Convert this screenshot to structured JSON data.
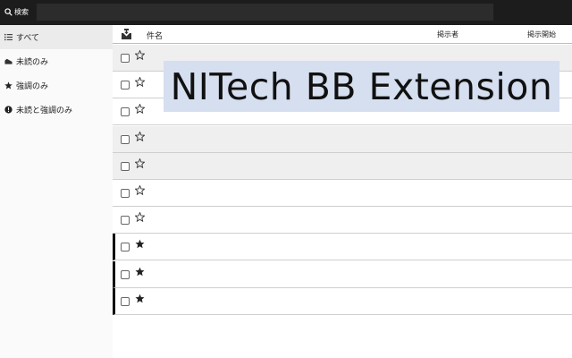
{
  "search": {
    "label": "検索",
    "value": "",
    "placeholder": ""
  },
  "sidebar": {
    "items": [
      {
        "label": "すべて",
        "icon": "list-icon",
        "active": true
      },
      {
        "label": "未読のみ",
        "icon": "unread-mail-icon",
        "active": false
      },
      {
        "label": "強調のみ",
        "icon": "star-icon",
        "active": false
      },
      {
        "label": "未読と強調のみ",
        "icon": "info-icon",
        "active": false
      }
    ]
  },
  "table": {
    "header_icon": "mail-icon",
    "columns": {
      "subject": "件名",
      "poster": "掲示者",
      "start": "掲示開始"
    },
    "rows": [
      {
        "starred": false,
        "shaded": true
      },
      {
        "starred": false,
        "shaded": false
      },
      {
        "starred": false,
        "shaded": false
      },
      {
        "starred": false,
        "shaded": true
      },
      {
        "starred": false,
        "shaded": true
      },
      {
        "starred": false,
        "shaded": false
      },
      {
        "starred": false,
        "shaded": false
      },
      {
        "starred": true,
        "shaded": false
      },
      {
        "starred": true,
        "shaded": false
      },
      {
        "starred": true,
        "shaded": false
      }
    ]
  },
  "banner": {
    "title": "NITech BB Extension"
  },
  "colors": {
    "topbar": "#1c1c1c",
    "banner_bg": "#d5dff0",
    "row_shade": "#efefef",
    "sidebar_active": "#ebebeb"
  }
}
